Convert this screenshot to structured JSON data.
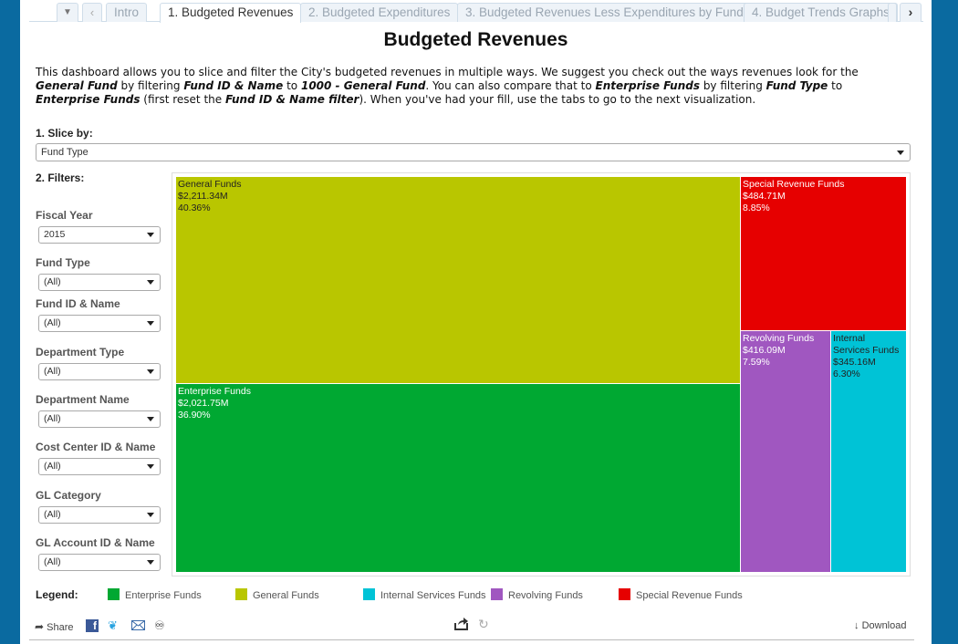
{
  "tabs": {
    "menu_icon": "chevron-down-icon",
    "prev_icon": "chevron-left-icon",
    "next_icon": "chevron-right-icon",
    "items": [
      {
        "label": "Intro",
        "active": false
      },
      {
        "label": "1. Budgeted Revenues",
        "active": true
      },
      {
        "label": "2. Budgeted Expenditures",
        "active": false
      },
      {
        "label": "3. Budgeted Revenues Less Expenditures by Fund",
        "active": false
      },
      {
        "label": "4. Budget Trends Graphs",
        "active": false
      }
    ]
  },
  "header": {
    "title": "Budgeted Revenues",
    "intro": {
      "t1": "This dashboard allows you to slice and filter the City's budgeted revenues in multiple ways. We suggest you check out the ways revenues look for the ",
      "b1": "General Fund",
      "t2": " by filtering ",
      "b2": "Fund ID & Name",
      "t3": " to ",
      "b3": "1000 - General Fund",
      "t4": ". You can also compare that to ",
      "b4": "Enterprise Funds",
      "t5": " by filtering ",
      "b5": "Fund Type",
      "t6": " to ",
      "b6": "Enterprise Funds",
      "t7": " (first reset the ",
      "b7": "Fund ID & Name filter",
      "t8": "). When you've had your fill, use the tabs to go to the next visualization."
    }
  },
  "slice": {
    "label": "1. Slice by:",
    "value": "Fund Type"
  },
  "filters": {
    "label": "2. Filters:",
    "items": [
      {
        "label": "Fiscal Year",
        "value": "2015"
      },
      {
        "label": "Fund Type",
        "value": "(All)"
      },
      {
        "label": "Fund ID & Name",
        "value": "(All)"
      },
      {
        "label": "Department Type",
        "value": "(All)"
      },
      {
        "label": "Department Name",
        "value": "(All)"
      },
      {
        "label": "Cost Center ID & Name",
        "value": "(All)"
      },
      {
        "label": "GL Category",
        "value": "(All)"
      },
      {
        "label": "GL Account ID & Name",
        "value": "(All)"
      }
    ]
  },
  "treemap": {
    "cells": [
      {
        "name": "General Funds",
        "amount": "$2,211.34M",
        "percent": "40.36%",
        "color": "#b9c600",
        "text_color": "#222222"
      },
      {
        "name": "Enterprise Funds",
        "amount": "$2,021.75M",
        "percent": "36.90%",
        "color": "#00a832",
        "text_color": "#ffffff"
      },
      {
        "name": "Special Revenue Funds",
        "amount": "$484.71M",
        "percent": "8.85%",
        "color": "#e60000",
        "text_color": "#ffffff"
      },
      {
        "name": "Revolving Funds",
        "amount": "$416.09M",
        "percent": "7.59%",
        "color": "#a057c0",
        "text_color": "#ffffff"
      },
      {
        "name": "Internal Services Funds",
        "amount": "$345.16M",
        "percent": "6.30%",
        "color": "#00c3d6",
        "text_color": "#222222"
      }
    ]
  },
  "legend": {
    "title": "Legend:",
    "items": [
      {
        "label": "Enterprise Funds",
        "color": "#00a832"
      },
      {
        "label": "General Funds",
        "color": "#b9c600"
      },
      {
        "label": "Internal Services Funds",
        "color": "#00c3d6"
      },
      {
        "label": "Revolving Funds",
        "color": "#a057c0"
      },
      {
        "label": "Special Revenue Funds",
        "color": "#e60000"
      }
    ]
  },
  "footer": {
    "share_label": "Share",
    "download_label": "Download"
  }
}
